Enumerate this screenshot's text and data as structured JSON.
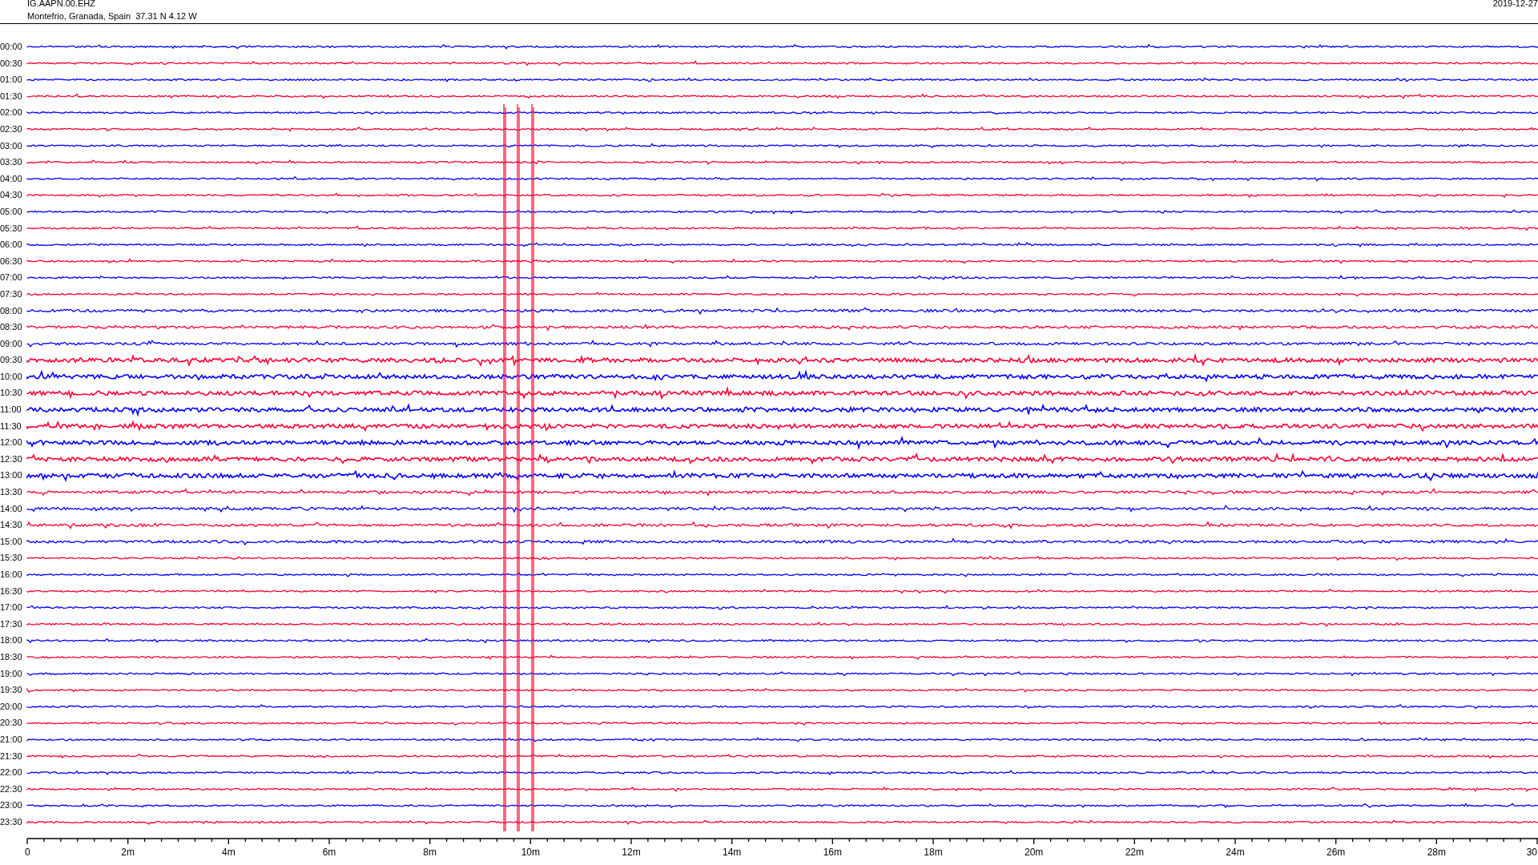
{
  "header": {
    "station": "IG.AAPN.00.EHZ",
    "location": "Montefrio, Granada, Spain  37.31 N 4.12 W",
    "date": "2019-12-27"
  },
  "rows": [
    {
      "time": "00:00",
      "color": "#0000ff"
    },
    {
      "time": "00:30",
      "color": "#ff0033"
    },
    {
      "time": "01:00",
      "color": "#0000ff"
    },
    {
      "time": "01:30",
      "color": "#ff0033"
    },
    {
      "time": "02:00",
      "color": "#0000ff"
    },
    {
      "time": "02:30",
      "color": "#ff0033"
    },
    {
      "time": "03:00",
      "color": "#0000ff"
    },
    {
      "time": "03:30",
      "color": "#ff0033"
    },
    {
      "time": "04:00",
      "color": "#0000ff"
    },
    {
      "time": "04:30",
      "color": "#ff0033"
    },
    {
      "time": "05:00",
      "color": "#0000ff"
    },
    {
      "time": "05:30",
      "color": "#ff0033"
    },
    {
      "time": "06:00",
      "color": "#0000ff"
    },
    {
      "time": "06:30",
      "color": "#ff0033"
    },
    {
      "time": "07:00",
      "color": "#0000ff"
    },
    {
      "time": "07:30",
      "color": "#ff0033"
    },
    {
      "time": "08:00",
      "color": "#0000ff"
    },
    {
      "time": "08:30",
      "color": "#ff0033"
    },
    {
      "time": "09:00",
      "color": "#0000ff"
    },
    {
      "time": "09:30",
      "color": "#ff0033"
    },
    {
      "time": "10:00",
      "color": "#0000ff"
    },
    {
      "time": "10:30",
      "color": "#ff0033"
    },
    {
      "time": "11:00",
      "color": "#0000ff"
    },
    {
      "time": "11:30",
      "color": "#ff0033"
    },
    {
      "time": "12:00",
      "color": "#0000ff"
    },
    {
      "time": "12:30",
      "color": "#ff0033"
    },
    {
      "time": "13:00",
      "color": "#0000ff"
    },
    {
      "time": "13:30",
      "color": "#ff0033"
    },
    {
      "time": "14:00",
      "color": "#0000ff"
    },
    {
      "time": "14:30",
      "color": "#ff0033"
    },
    {
      "time": "15:00",
      "color": "#0000ff"
    },
    {
      "time": "15:30",
      "color": "#ff0033"
    },
    {
      "time": "16:00",
      "color": "#0000ff"
    },
    {
      "time": "16:30",
      "color": "#ff0033"
    },
    {
      "time": "17:00",
      "color": "#0000ff"
    },
    {
      "time": "17:30",
      "color": "#ff0033"
    },
    {
      "time": "18:00",
      "color": "#0000ff"
    },
    {
      "time": "18:30",
      "color": "#ff0033"
    },
    {
      "time": "19:00",
      "color": "#0000ff"
    },
    {
      "time": "19:30",
      "color": "#ff0033"
    },
    {
      "time": "20:00",
      "color": "#0000ff"
    },
    {
      "time": "20:30",
      "color": "#ff0033"
    },
    {
      "time": "21:00",
      "color": "#0000ff"
    },
    {
      "time": "21:30",
      "color": "#ff0033"
    },
    {
      "time": "22:00",
      "color": "#0000ff"
    },
    {
      "time": "22:30",
      "color": "#ff0033"
    },
    {
      "time": "23:00",
      "color": "#0000ff"
    },
    {
      "time": "23:30",
      "color": "#ff0033"
    }
  ],
  "axis": {
    "labels": [
      "0",
      "2m",
      "4m",
      "6m",
      "8m",
      "10m",
      "12m",
      "14m",
      "16m",
      "18m",
      "20m",
      "22m",
      "24m",
      "26m",
      "28m",
      "30"
    ]
  }
}
